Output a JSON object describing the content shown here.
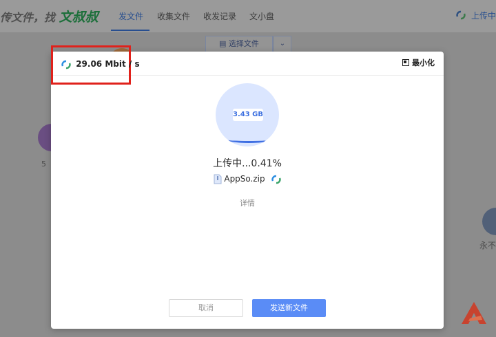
{
  "app": {
    "brand_text": "传文件，找",
    "brand_highlight": "文叔叔",
    "nav": [
      {
        "label": "发文件",
        "active": true
      },
      {
        "label": "收集文件",
        "active": false
      },
      {
        "label": "收发记录",
        "active": false
      },
      {
        "label": "文小盘",
        "active": false
      }
    ],
    "top_right_label": "上传中",
    "choose_file_label": "选择文件",
    "bg_left_label": "5",
    "bg_right_label": "永不"
  },
  "modal": {
    "speed": "29.06 Mbit / s",
    "minimize_label": "最小化",
    "file_size": "3.43 GB",
    "progress_percent": 0.41,
    "status_text": "上传中...0.41%",
    "file_name": "AppSo.zip",
    "details_label": "详情",
    "cancel_label": "取消",
    "send_new_label": "发送新文件"
  },
  "colors": {
    "accent": "#5a8cf6",
    "highlight_box": "#e0211b",
    "progress_bg": "#dbe6ff"
  },
  "icons": [
    "loading-icon",
    "minimize-icon",
    "zip-file-icon",
    "chevron-down-icon",
    "file-icon"
  ]
}
